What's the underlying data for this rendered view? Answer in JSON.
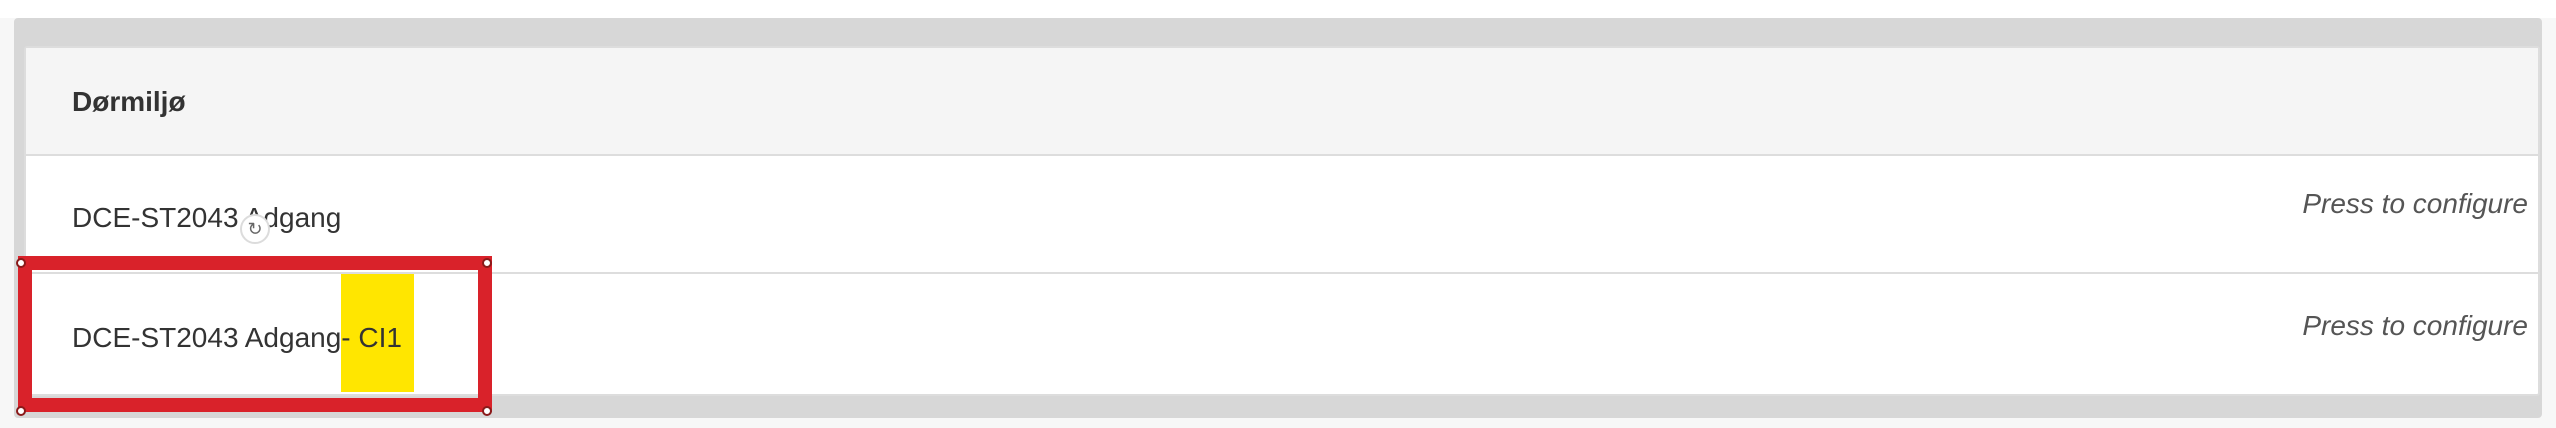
{
  "panel": {
    "title": "Dørmiljø",
    "rows": [
      {
        "label": "DCE-ST2043 Adgang",
        "hint": "Press to configure"
      },
      {
        "label_main": "DCE-ST2043 Adgang",
        "label_highlight": " - CI1",
        "hint": "Press to configure"
      }
    ]
  },
  "annotation": {
    "color": "#d9222a",
    "highlight_color": "#ffe600"
  },
  "icons": {
    "cursor": "loading-cursor-icon"
  }
}
